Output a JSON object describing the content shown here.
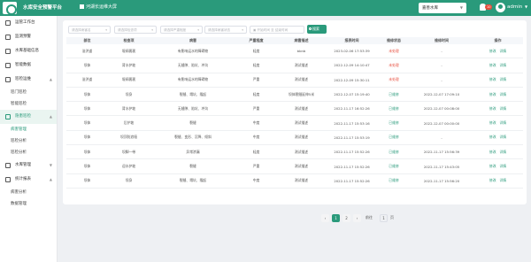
{
  "header": {
    "app_title": "水库安全预警平台",
    "nav_label": "河湖长运维大屏",
    "region_select": "嘉善水库",
    "notification_count": "10",
    "username": "admin"
  },
  "sidebar": {
    "items": [
      {
        "label": "运管工作台",
        "active": false
      },
      {
        "label": "监测预警",
        "active": false
      },
      {
        "label": "水库基础信息",
        "active": false
      },
      {
        "label": "智能数据",
        "active": false
      },
      {
        "label": "巡检运维",
        "active": false,
        "children": [
          "巡门巡检",
          "智能巡检"
        ]
      },
      {
        "label": "隐患巡检",
        "active": true,
        "children": [
          "病害管理",
          "巡检分析",
          "巡检分析"
        ]
      },
      {
        "label": "水库管理",
        "active": false
      },
      {
        "label": "统计报表",
        "active": false,
        "children": [
          "病害分析",
          "数据管理"
        ]
      }
    ],
    "active_sub": "病害管理"
  },
  "filters": {
    "f1": "请选择病害名",
    "f2": "请选择检查项",
    "f3": "请选择严重程度",
    "f4": "请选择病害状态",
    "date_start": "开始时间",
    "date_sep": "至",
    "date_end": "结束时间",
    "search_label": "搜索"
  },
  "table": {
    "headers": [
      "部位",
      "检查项",
      "病害",
      "严重程度",
      "病害描述",
      "报表时间",
      "维修状态",
      "维修时间",
      "操作"
    ],
    "rows": [
      [
        "溢洪道",
        "堰闸裹裹",
        "有影响运水的障碍物",
        "轻度",
        "bbnb",
        "2023-02-06 17:53:39",
        "未处理",
        "-"
      ],
      [
        "坝体",
        "背水护坡",
        "无缝隙、陷坑、冲沟",
        "轻度",
        "测试描述",
        "2022-12-09 14:10:47",
        "未处理",
        "-"
      ],
      [
        "溢洪道",
        "堰闸裹裹",
        "有影响运水的障碍物",
        "严重",
        "测试描述",
        "2022-12-09 15:30:11",
        "未处理",
        "-"
      ],
      [
        "坝体",
        "坝身",
        "裂缝、塌坑、隆起",
        "轻度",
        "坝体裂缝延伸5米",
        "2022-12-07 15:19:40",
        "已维修",
        "2022-12-07 17:09:10"
      ],
      [
        "坝体",
        "背水护坡",
        "无缝隙、陷坑、冲沟",
        "严重",
        "测试描述",
        "2022-11-17 16:52:26",
        "已维修",
        "2022-12-07 00:08:00"
      ],
      [
        "坝体",
        "后护坡",
        "裂缝",
        "中度",
        "测试描述",
        "2022-11-17 15:53:16",
        "已维修",
        "2022-12-07 00:00:00"
      ],
      [
        "坝体",
        "坝顶防浪墙",
        "裂缝、变形、沉降、倾斜",
        "中度",
        "测试描述",
        "2022-11-17 15:53:19",
        "已维修",
        "-"
      ],
      [
        "坝体",
        "坝脚一带",
        "异常渗漏",
        "轻度",
        "测试描述",
        "2022-11-17 15:52:26",
        "已维修",
        "2022-11-17 15:56:39"
      ],
      [
        "坝体",
        "迎水护坡",
        "裂缝",
        "严重",
        "测试描述",
        "2022-11-17 15:52:26",
        "已维修",
        "2022-11-17 15:43:05"
      ],
      [
        "坝体",
        "坝身",
        "裂缝、塌坑、隆起",
        "中度",
        "测试描述",
        "2022-11-17 15:52:26",
        "已维修",
        "2022-11-17 15:56:20"
      ]
    ],
    "action_view": "修改",
    "action_detail": "详情"
  },
  "pagination": {
    "prev": "‹",
    "pages": [
      "1",
      "2"
    ],
    "next": "›",
    "goto_label": "前往",
    "goto_value": "1",
    "page_unit": "页"
  },
  "colors": {
    "brand": "#2a9a7b",
    "danger": "#e74c3c"
  }
}
